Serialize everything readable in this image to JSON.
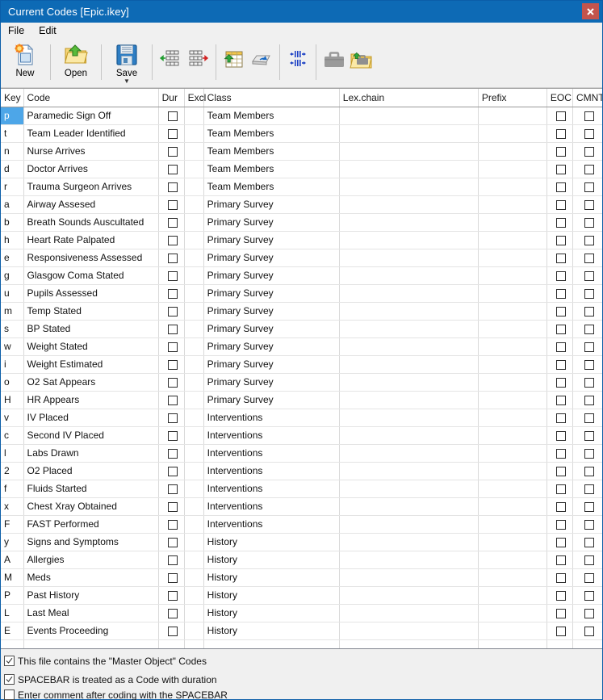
{
  "window": {
    "title": "Current Codes [Epic.ikey]",
    "close_label": "x",
    "titlebar_color": "#0d6ab5",
    "close_color": "#c3544d",
    "selection_color": "#4da6e8"
  },
  "menubar": {
    "items": [
      {
        "label": "File",
        "name": "menu-file"
      },
      {
        "label": "Edit",
        "name": "menu-edit"
      }
    ]
  },
  "toolbar": {
    "buttons": [
      {
        "label": "New",
        "icon": "new-document-icon",
        "name": "new-button"
      },
      {
        "label": "Open",
        "icon": "open-folder-icon",
        "name": "open-button"
      },
      {
        "label": "Save",
        "icon": "floppy-disk-icon",
        "name": "save-button",
        "caret": "▼"
      }
    ],
    "small_buttons": [
      {
        "icon": "insert-row-left-icon",
        "name": "insert-row-left-button"
      },
      {
        "icon": "insert-row-right-icon",
        "name": "insert-row-right-button"
      },
      {
        "icon": "import-table-icon",
        "name": "import-table-button"
      },
      {
        "icon": "keyboard-key-icon",
        "name": "keyboard-key-button"
      },
      {
        "icon": "adjust-duration-icon",
        "name": "adjust-duration-button"
      },
      {
        "icon": "toolbox-icon",
        "name": "toolbox-button"
      },
      {
        "icon": "open-toolbox-icon",
        "name": "open-toolbox-button"
      }
    ]
  },
  "grid": {
    "columns": [
      {
        "label": "Key",
        "name": "column-key"
      },
      {
        "label": "Code",
        "name": "column-code"
      },
      {
        "label": "Dur",
        "name": "column-dur"
      },
      {
        "label": "Excl",
        "name": "column-excl"
      },
      {
        "label": "Class",
        "name": "column-class"
      },
      {
        "label": "Lex.chain",
        "name": "column-lexchain"
      },
      {
        "label": "Prefix",
        "name": "column-prefix"
      },
      {
        "label": "EOC",
        "name": "column-eoc"
      },
      {
        "label": "CMNT",
        "name": "column-cmnt"
      }
    ],
    "selected_row": 0,
    "rows": [
      {
        "key": "p",
        "code": "Paramedic Sign Off",
        "dur": false,
        "excl": "",
        "class": "Team Members",
        "lexchain": "",
        "prefix": "",
        "eoc": false,
        "cmnt": false
      },
      {
        "key": "t",
        "code": "Team Leader Identified",
        "dur": false,
        "excl": "",
        "class": "Team Members",
        "lexchain": "",
        "prefix": "",
        "eoc": false,
        "cmnt": false
      },
      {
        "key": "n",
        "code": "Nurse Arrives",
        "dur": false,
        "excl": "",
        "class": "Team Members",
        "lexchain": "",
        "prefix": "",
        "eoc": false,
        "cmnt": false
      },
      {
        "key": "d",
        "code": "Doctor Arrives",
        "dur": false,
        "excl": "",
        "class": "Team Members",
        "lexchain": "",
        "prefix": "",
        "eoc": false,
        "cmnt": false
      },
      {
        "key": "r",
        "code": "Trauma Surgeon Arrives",
        "dur": false,
        "excl": "",
        "class": "Team Members",
        "lexchain": "",
        "prefix": "",
        "eoc": false,
        "cmnt": false
      },
      {
        "key": "a",
        "code": "Airway Assesed",
        "dur": false,
        "excl": "",
        "class": "Primary Survey",
        "lexchain": "",
        "prefix": "",
        "eoc": false,
        "cmnt": false
      },
      {
        "key": "b",
        "code": "Breath Sounds Auscultated",
        "dur": false,
        "excl": "",
        "class": "Primary Survey",
        "lexchain": "",
        "prefix": "",
        "eoc": false,
        "cmnt": false
      },
      {
        "key": "h",
        "code": "Heart Rate Palpated",
        "dur": false,
        "excl": "",
        "class": "Primary Survey",
        "lexchain": "",
        "prefix": "",
        "eoc": false,
        "cmnt": false
      },
      {
        "key": "e",
        "code": "Responsiveness Assessed",
        "dur": false,
        "excl": "",
        "class": "Primary Survey",
        "lexchain": "",
        "prefix": "",
        "eoc": false,
        "cmnt": false
      },
      {
        "key": "g",
        "code": "Glasgow Coma Stated",
        "dur": false,
        "excl": "",
        "class": "Primary Survey",
        "lexchain": "",
        "prefix": "",
        "eoc": false,
        "cmnt": false
      },
      {
        "key": "u",
        "code": "Pupils Assessed",
        "dur": false,
        "excl": "",
        "class": "Primary Survey",
        "lexchain": "",
        "prefix": "",
        "eoc": false,
        "cmnt": false
      },
      {
        "key": "m",
        "code": "Temp Stated",
        "dur": false,
        "excl": "",
        "class": "Primary Survey",
        "lexchain": "",
        "prefix": "",
        "eoc": false,
        "cmnt": false
      },
      {
        "key": "s",
        "code": "BP Stated",
        "dur": false,
        "excl": "",
        "class": "Primary Survey",
        "lexchain": "",
        "prefix": "",
        "eoc": false,
        "cmnt": false
      },
      {
        "key": "w",
        "code": "Weight Stated",
        "dur": false,
        "excl": "",
        "class": "Primary Survey",
        "lexchain": "",
        "prefix": "",
        "eoc": false,
        "cmnt": false
      },
      {
        "key": "i",
        "code": "Weight Estimated",
        "dur": false,
        "excl": "",
        "class": "Primary Survey",
        "lexchain": "",
        "prefix": "",
        "eoc": false,
        "cmnt": false
      },
      {
        "key": "o",
        "code": "O2 Sat Appears",
        "dur": false,
        "excl": "",
        "class": "Primary Survey",
        "lexchain": "",
        "prefix": "",
        "eoc": false,
        "cmnt": false
      },
      {
        "key": "H",
        "code": "HR Appears",
        "dur": false,
        "excl": "",
        "class": "Primary Survey",
        "lexchain": "",
        "prefix": "",
        "eoc": false,
        "cmnt": false
      },
      {
        "key": "v",
        "code": "IV Placed",
        "dur": false,
        "excl": "",
        "class": "Interventions",
        "lexchain": "",
        "prefix": "",
        "eoc": false,
        "cmnt": false
      },
      {
        "key": "c",
        "code": "Second IV Placed",
        "dur": false,
        "excl": "",
        "class": "Interventions",
        "lexchain": "",
        "prefix": "",
        "eoc": false,
        "cmnt": false
      },
      {
        "key": "l",
        "code": "Labs Drawn",
        "dur": false,
        "excl": "",
        "class": "Interventions",
        "lexchain": "",
        "prefix": "",
        "eoc": false,
        "cmnt": false
      },
      {
        "key": "2",
        "code": "O2 Placed",
        "dur": false,
        "excl": "",
        "class": "Interventions",
        "lexchain": "",
        "prefix": "",
        "eoc": false,
        "cmnt": false
      },
      {
        "key": "f",
        "code": "Fluids Started",
        "dur": false,
        "excl": "",
        "class": "Interventions",
        "lexchain": "",
        "prefix": "",
        "eoc": false,
        "cmnt": false
      },
      {
        "key": "x",
        "code": "Chest Xray Obtained",
        "dur": false,
        "excl": "",
        "class": "Interventions",
        "lexchain": "",
        "prefix": "",
        "eoc": false,
        "cmnt": false
      },
      {
        "key": "F",
        "code": "FAST Performed",
        "dur": false,
        "excl": "",
        "class": "Interventions",
        "lexchain": "",
        "prefix": "",
        "eoc": false,
        "cmnt": false
      },
      {
        "key": "y",
        "code": "Signs and Symptoms",
        "dur": false,
        "excl": "",
        "class": "History",
        "lexchain": "",
        "prefix": "",
        "eoc": false,
        "cmnt": false
      },
      {
        "key": "A",
        "code": "Allergies",
        "dur": false,
        "excl": "",
        "class": "History",
        "lexchain": "",
        "prefix": "",
        "eoc": false,
        "cmnt": false
      },
      {
        "key": "M",
        "code": "Meds",
        "dur": false,
        "excl": "",
        "class": "History",
        "lexchain": "",
        "prefix": "",
        "eoc": false,
        "cmnt": false
      },
      {
        "key": "P",
        "code": "Past History",
        "dur": false,
        "excl": "",
        "class": "History",
        "lexchain": "",
        "prefix": "",
        "eoc": false,
        "cmnt": false
      },
      {
        "key": "L",
        "code": "Last Meal",
        "dur": false,
        "excl": "",
        "class": "History",
        "lexchain": "",
        "prefix": "",
        "eoc": false,
        "cmnt": false
      },
      {
        "key": "E",
        "code": "Events Proceeding",
        "dur": false,
        "excl": "",
        "class": "History",
        "lexchain": "",
        "prefix": "",
        "eoc": false,
        "cmnt": false
      }
    ]
  },
  "options": [
    {
      "label": "This file contains the \"Master Object\" Codes",
      "checked": true,
      "name": "option-master-object-codes"
    },
    {
      "label": "SPACEBAR is treated as a Code with duration",
      "checked": true,
      "name": "option-spacebar-duration"
    },
    {
      "label": "Enter comment after coding with the SPACEBAR",
      "checked": false,
      "name": "option-comment-after-spacebar"
    }
  ]
}
